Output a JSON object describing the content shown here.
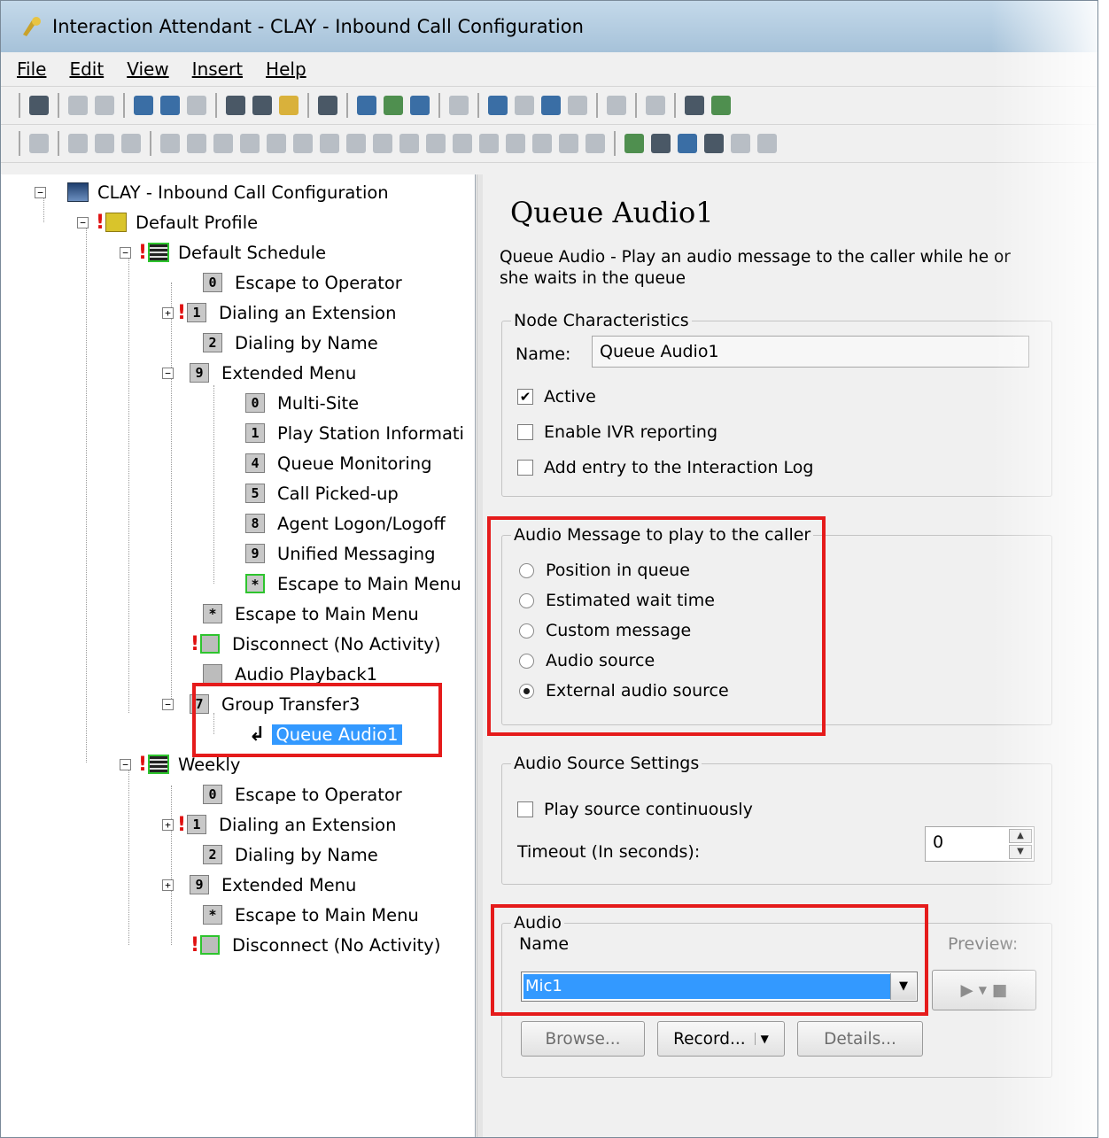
{
  "window": {
    "title": "Interaction Attendant - CLAY - Inbound Call Configuration"
  },
  "menu": {
    "file": "File",
    "edit": "Edit",
    "view": "View",
    "insert": "Insert",
    "help": "Help"
  },
  "tree": {
    "root": "CLAY - Inbound Call Configuration",
    "profile": "Default Profile",
    "schedule": "Default Schedule",
    "schedule_items": [
      {
        "key": "0",
        "label": "Escape to Operator"
      },
      {
        "key": "1",
        "label": "Dialing an Extension"
      },
      {
        "key": "2",
        "label": "Dialing by Name"
      },
      {
        "key": "9",
        "label": "Extended Menu"
      }
    ],
    "extended_items": [
      {
        "key": "0",
        "label": "Multi-Site"
      },
      {
        "key": "1",
        "label": "Play Station Informati"
      },
      {
        "key": "4",
        "label": "Queue Monitoring"
      },
      {
        "key": "5",
        "label": "Call Picked-up"
      },
      {
        "key": "8",
        "label": "Agent Logon/Logoff"
      },
      {
        "key": "9",
        "label": "Unified Messaging"
      },
      {
        "key": "*",
        "label": "Escape to Main Menu"
      }
    ],
    "schedule_tail": [
      {
        "key": "*",
        "label": "Escape to Main Menu"
      },
      {
        "key": "",
        "label": "Disconnect (No Activity)"
      },
      {
        "key": "",
        "label": "Audio Playback1"
      },
      {
        "key": "7",
        "label": "Group Transfer3"
      }
    ],
    "selected": "Queue Audio1",
    "weekly": "Weekly",
    "weekly_items": [
      {
        "key": "0",
        "label": "Escape to Operator"
      },
      {
        "key": "1",
        "label": "Dialing an Extension"
      },
      {
        "key": "2",
        "label": "Dialing by Name"
      },
      {
        "key": "9",
        "label": "Extended Menu"
      },
      {
        "key": "*",
        "label": "Escape to Main Menu"
      },
      {
        "key": "",
        "label": "Disconnect (No Activity)"
      }
    ]
  },
  "panel": {
    "title": "Queue Audio1",
    "description": "Queue Audio - Play an audio message to the caller while he or she waits in the queue",
    "node": {
      "legend": "Node Characteristics",
      "name_label": "Name:",
      "name_value": "Queue Audio1",
      "active": "Active",
      "ivr": "Enable IVR reporting",
      "log": "Add entry to the Interaction Log"
    },
    "message": {
      "legend": "Audio Message to play to the caller",
      "options": [
        "Position in queue",
        "Estimated wait time",
        "Custom message",
        "Audio source",
        "External audio source"
      ]
    },
    "source": {
      "legend": "Audio Source Settings",
      "continuous": "Play source continuously",
      "timeout_label": "Timeout (In seconds):",
      "timeout_value": "0"
    },
    "audio": {
      "legend": "Audio",
      "name_label": "Name",
      "selected": "Mic1",
      "preview": "Preview:",
      "browse": "Browse...",
      "record": "Record...",
      "details": "Details..."
    }
  }
}
